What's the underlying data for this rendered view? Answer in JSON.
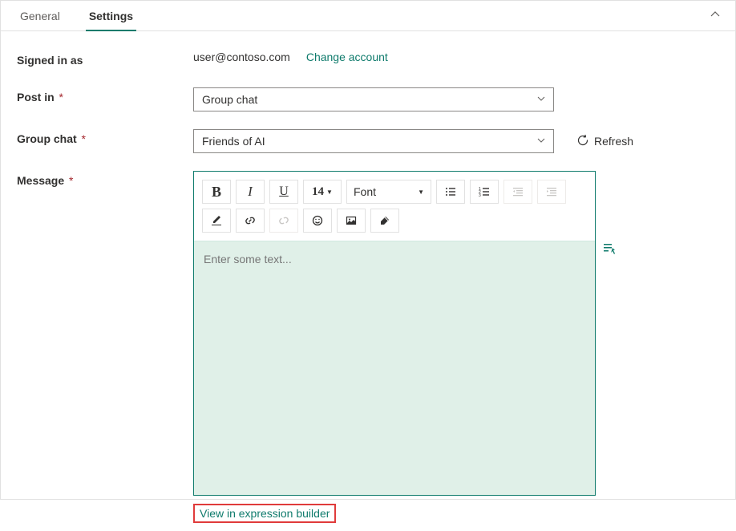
{
  "tabs": {
    "general": "General",
    "settings": "Settings"
  },
  "labels": {
    "signed_in": "Signed in as",
    "post_in": "Post in",
    "group_chat": "Group chat",
    "message": "Message"
  },
  "signed": {
    "email": "user@contoso.com",
    "change": "Change account"
  },
  "post_in": {
    "value": "Group chat"
  },
  "group_chat": {
    "value": "Friends of AI",
    "refresh": "Refresh"
  },
  "editor": {
    "placeholder": "Enter some text...",
    "fontsize": "14",
    "fontname": "Font"
  },
  "footer": {
    "expression": "View in expression builder"
  }
}
